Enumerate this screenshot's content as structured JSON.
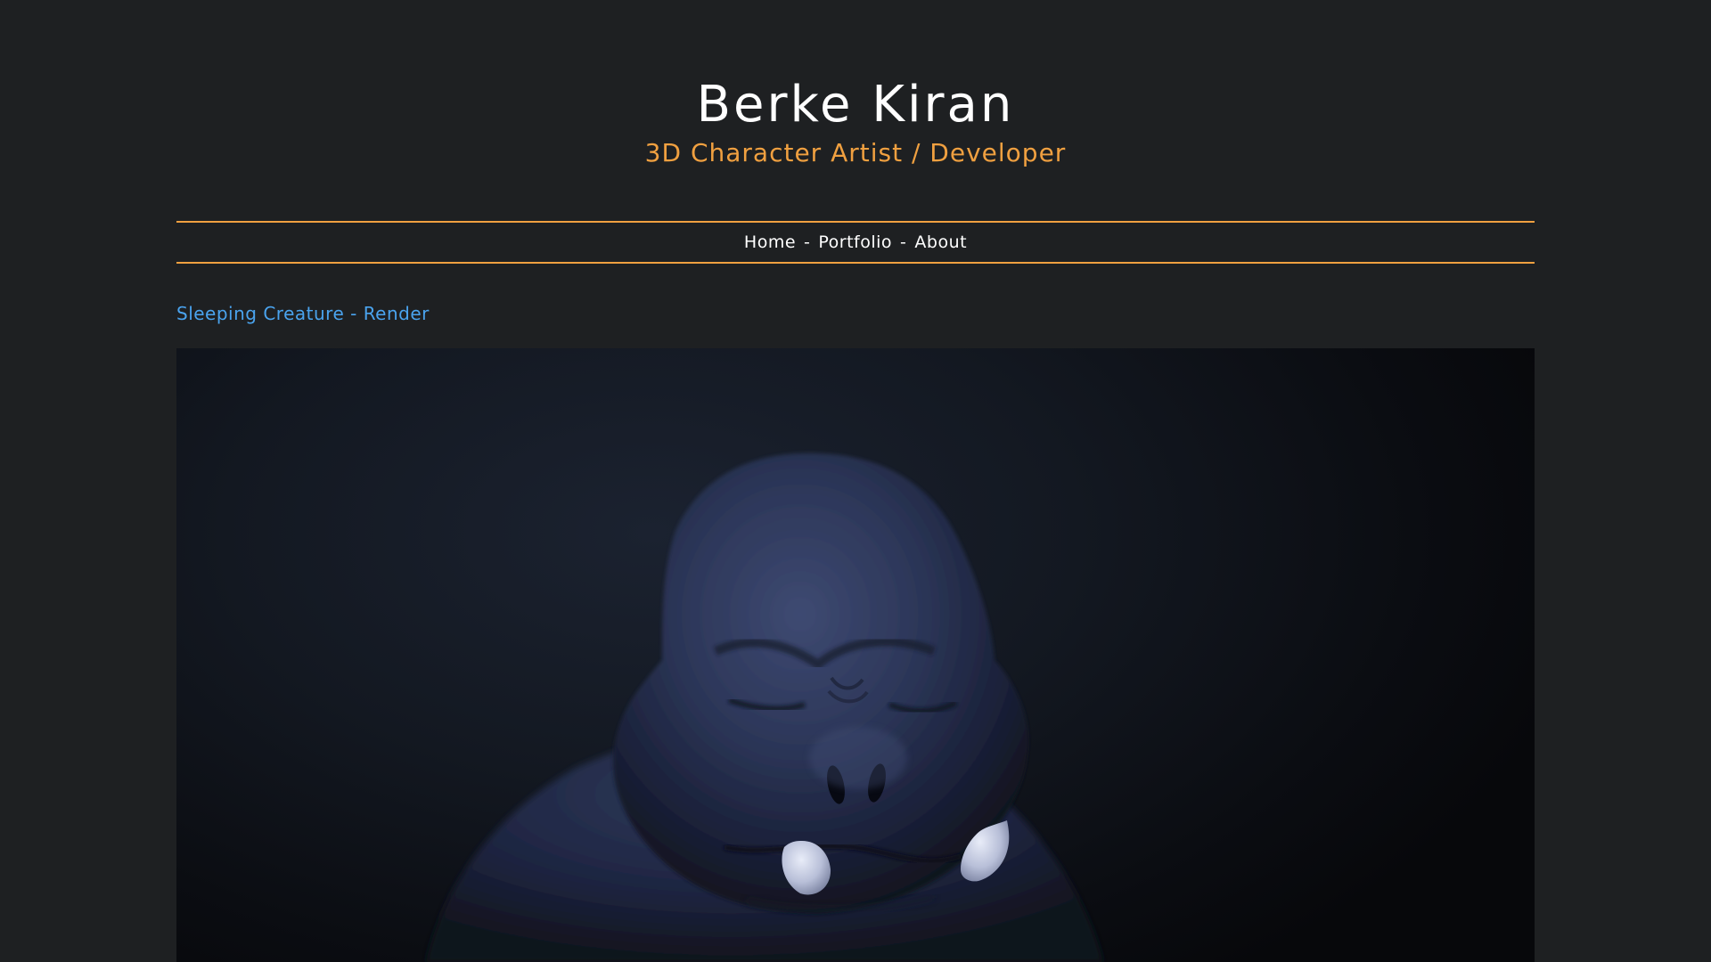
{
  "site": {
    "title": "Berke Kiran",
    "subtitle": "3D Character Artist / Developer"
  },
  "nav": {
    "items": [
      {
        "label": "Home"
      },
      {
        "label": "Portfolio"
      },
      {
        "label": "About"
      }
    ],
    "separator": "-"
  },
  "post": {
    "title": "Sleeping Creature - Render",
    "image_subject": "sleeping-creature-render"
  },
  "colors": {
    "background": "#1e2022",
    "accent": "#f0a040",
    "link": "#4aa3ee",
    "text": "#ffffff"
  }
}
